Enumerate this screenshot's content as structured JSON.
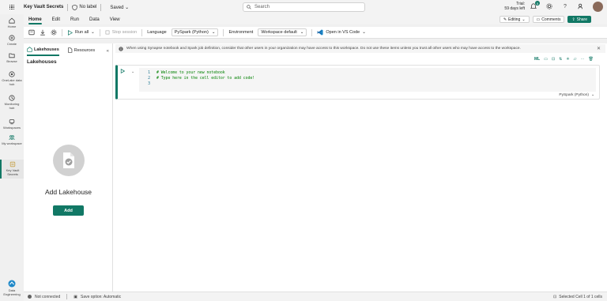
{
  "header": {
    "title": "Key Vault Secrets",
    "label": "No label",
    "saved": "Saved",
    "search_placeholder": "Search",
    "trial_line1": "Trial:",
    "trial_line2": "59 days left",
    "notification_count": "5"
  },
  "rail": {
    "items": [
      {
        "label": "Home"
      },
      {
        "label": "Create"
      },
      {
        "label": "Browse"
      },
      {
        "label": "OneLake data hub"
      },
      {
        "label": "Monitoring hub"
      },
      {
        "label": "Workspaces"
      },
      {
        "label": "My workspace"
      },
      {
        "label": "Key Vault Secrets"
      },
      {
        "label": "Data Engineering"
      }
    ]
  },
  "menubar": {
    "tabs": [
      "Home",
      "Edit",
      "Run",
      "Data",
      "View"
    ],
    "editing": "Editing",
    "comments": "Comments",
    "share": "Share"
  },
  "toolbar": {
    "run_all": "Run all",
    "stop_session": "Stop session",
    "language_label": "Language",
    "language_value": "PySpark (Python)",
    "environment_label": "Environment",
    "environment_value": "Workspace default",
    "vscode": "Open in VS Code"
  },
  "leftpanel": {
    "tab_lakehouses": "Lakehouses",
    "tab_resources": "Resources",
    "heading": "Lakehouses",
    "add_title": "Add Lakehouse",
    "add_button": "Add"
  },
  "banner": {
    "text": "When using Synapse notebook and Spark job definition, consider that other users in your organization may have access to this workspace. Do not use these items unless you trust all other users who may have access to the workspace."
  },
  "cell": {
    "lines": [
      {
        "n": "1",
        "code": "# Welcome to your new notebook"
      },
      {
        "n": "2",
        "code": "# Type here in the cell editor to add code!"
      },
      {
        "n": "3",
        "code": ""
      }
    ],
    "language": "PySpark (Python)",
    "ml_label": "ML"
  },
  "status": {
    "connection": "Not connected",
    "save_option": "Save option: Automatic",
    "selection": "Selected Cell 1 of 1 cells"
  },
  "colors": {
    "accent": "#117865"
  }
}
